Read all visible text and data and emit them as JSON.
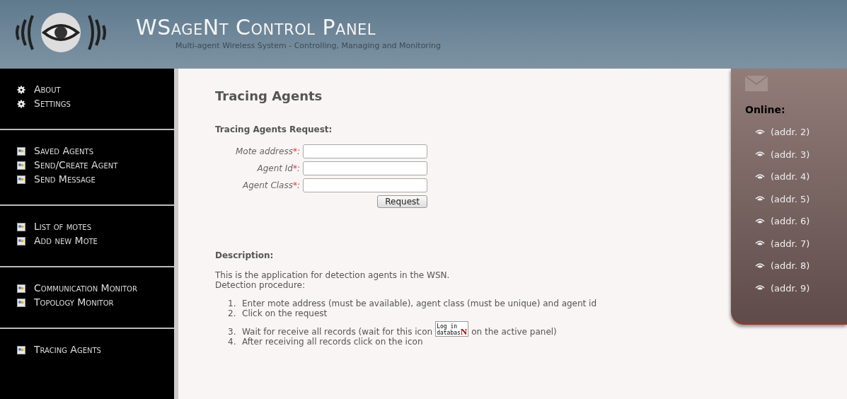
{
  "header": {
    "title": "WSageNt Control Panel",
    "subtitle": "Multi-agent Wireless System - Controlling, Managing and Monitoring"
  },
  "sidebar": {
    "groups": [
      {
        "items": [
          {
            "label": "About",
            "kind": "gear"
          },
          {
            "label": "Settings",
            "kind": "gear"
          }
        ]
      },
      {
        "items": [
          {
            "label": "Saved Agents",
            "kind": "page"
          },
          {
            "label": "Send/Create Agent",
            "kind": "page"
          },
          {
            "label": "Send Message",
            "kind": "page"
          }
        ]
      },
      {
        "items": [
          {
            "label": "List of motes",
            "kind": "page"
          },
          {
            "label": "Add new Mote",
            "kind": "page"
          }
        ]
      },
      {
        "items": [
          {
            "label": "Communication Monitor",
            "kind": "page"
          },
          {
            "label": "Topology Monitor",
            "kind": "page"
          }
        ]
      },
      {
        "items": [
          {
            "label": "Tracing Agents",
            "kind": "page"
          }
        ]
      }
    ]
  },
  "main": {
    "title": "Tracing Agents",
    "form_title": "Tracing Agents Request:",
    "fields": [
      {
        "label": "Mote address",
        "required_mark": "*",
        "suffix": ":"
      },
      {
        "label": "Agent Id",
        "required_mark": "*",
        "suffix": ":"
      },
      {
        "label": "Agent Class",
        "required_mark": "*",
        "suffix": ":"
      }
    ],
    "button": "Request",
    "description_title": "Description:",
    "description": [
      "This is the application for detection agents in the WSN.",
      "Detection procedure:"
    ],
    "steps": [
      {
        "number": "1.",
        "text": "Enter mote address (must be available), agent class (must be unique) and agent id"
      },
      {
        "number": "2.",
        "text": "Click on the request"
      },
      {
        "number": "3.",
        "text": "Wait for receive all records (wait for this icon",
        "badge": {
          "lines": [
            "Log in",
            "databas"
          ],
          "mark": "N"
        },
        "text_after": "on the active panel)"
      },
      {
        "number": "4.",
        "text": "After receiving all records click on the icon"
      }
    ]
  },
  "online_panel": {
    "title": "Online:",
    "motes": [
      "(addr. 2)",
      "(addr. 3)",
      "(addr. 4)",
      "(addr. 5)",
      "(addr. 6)",
      "(addr. 7)",
      "(addr. 8)",
      "(addr. 9)"
    ]
  }
}
